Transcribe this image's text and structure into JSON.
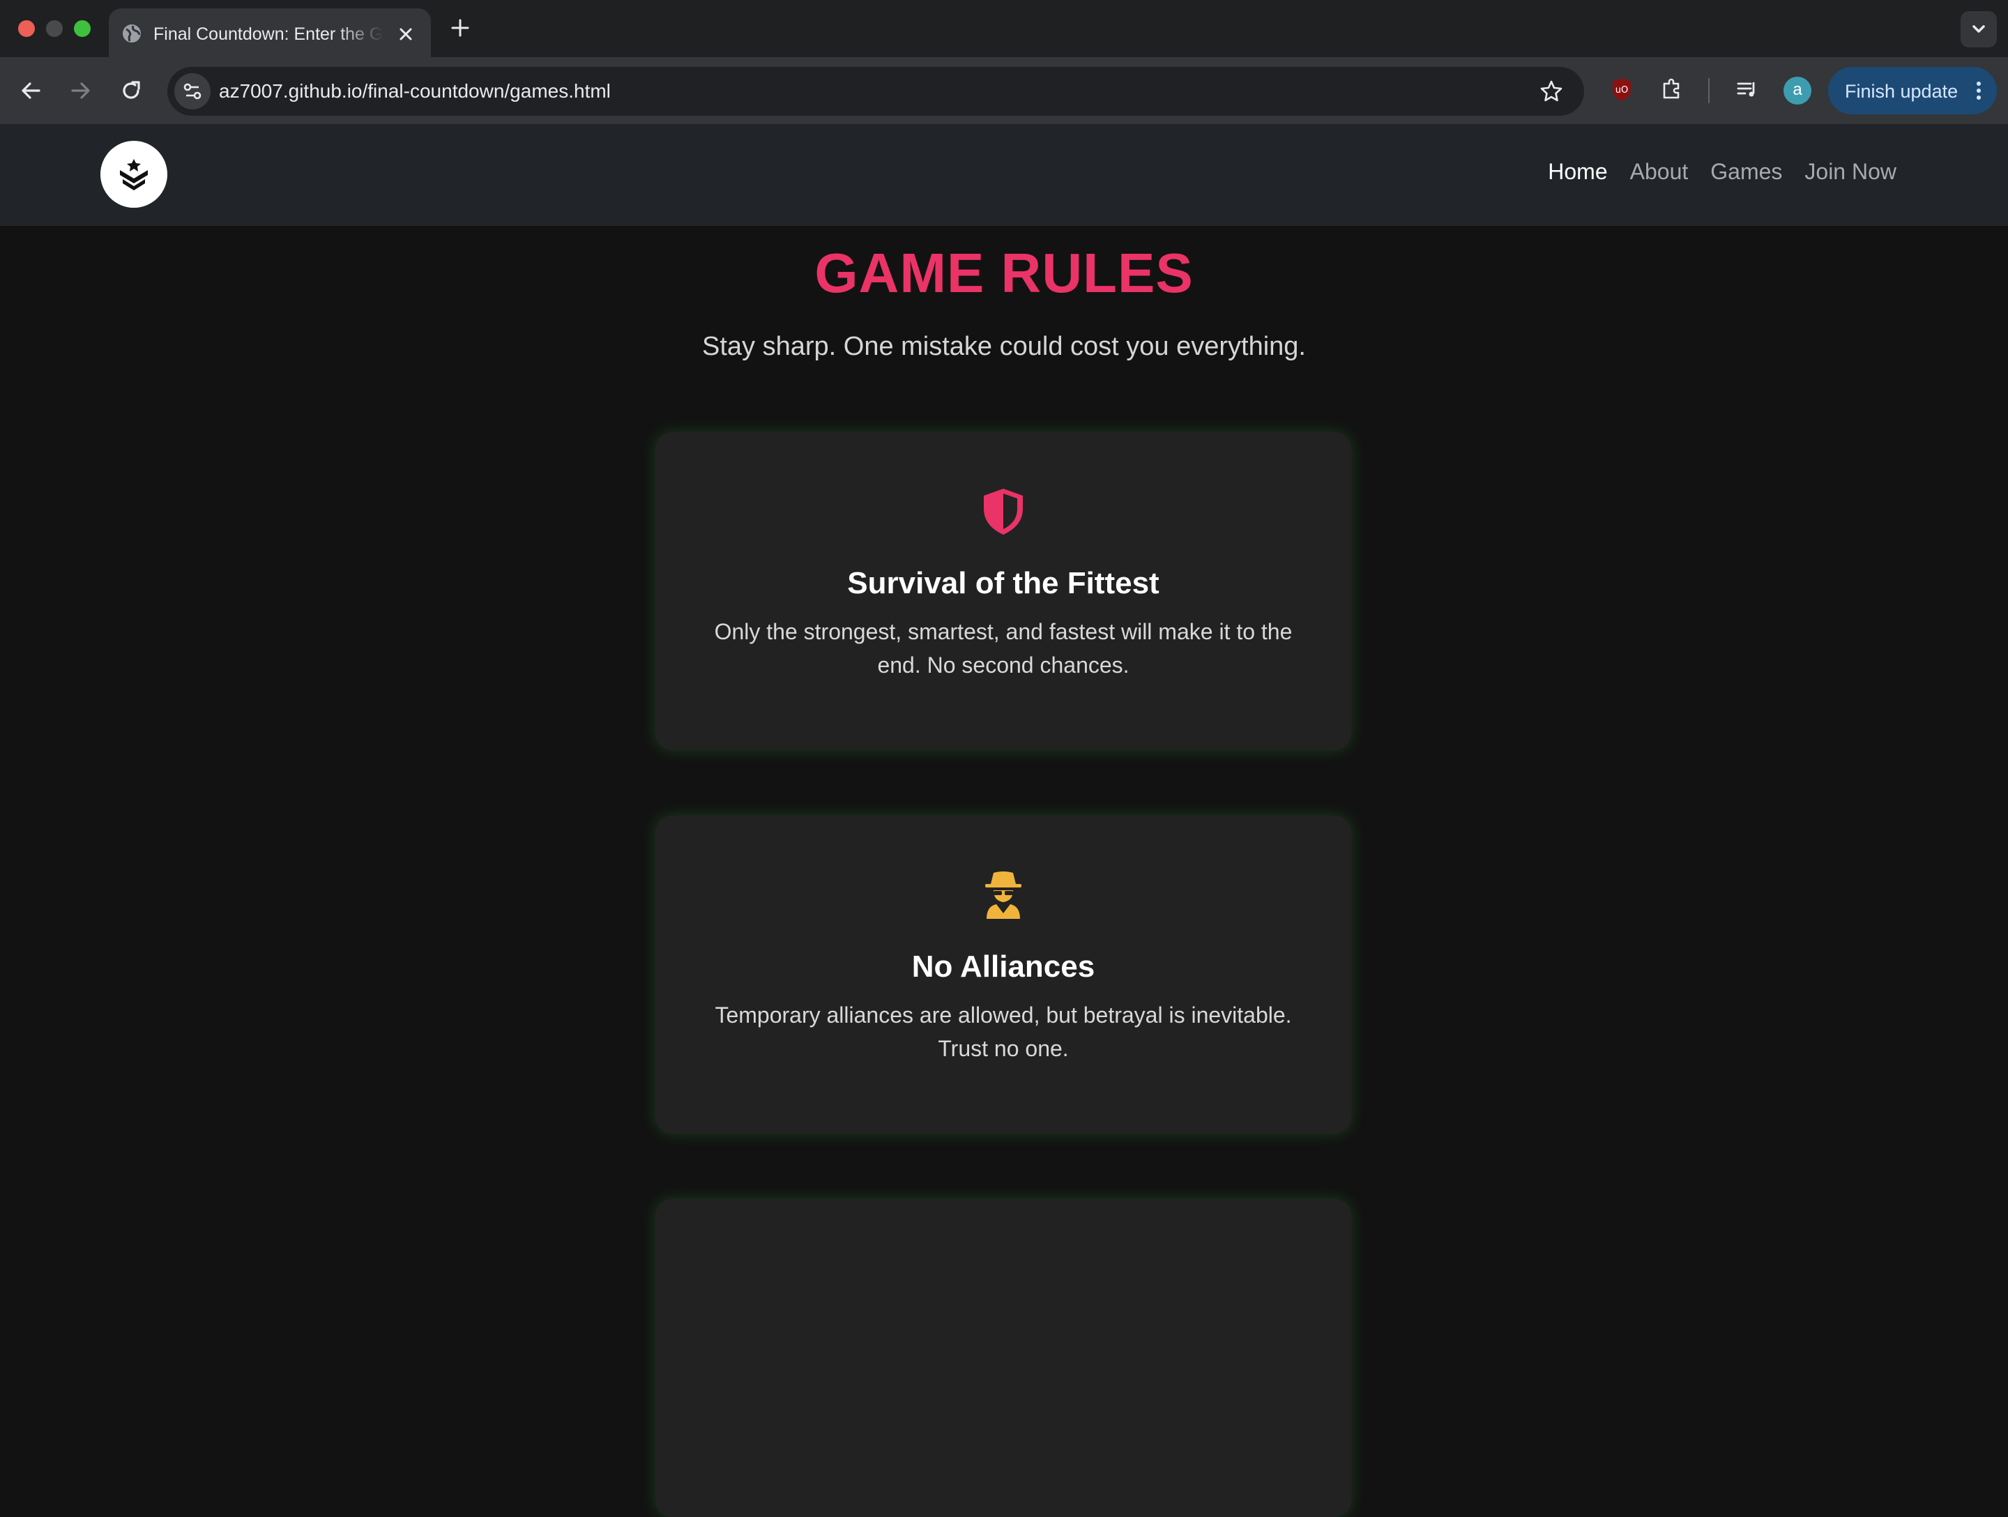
{
  "browser": {
    "tab_title": "Final Countdown: Enter the Game",
    "url": "az7007.github.io/final-countdown/games.html",
    "profile_initial": "a",
    "update_label": "Finish update",
    "colors": {
      "update_button": "#1c4a75",
      "avatar": "#3e9cb0"
    }
  },
  "nav": {
    "links": [
      {
        "label": "Home",
        "active": true
      },
      {
        "label": "About",
        "active": false
      },
      {
        "label": "Games",
        "active": false
      },
      {
        "label": "Join Now",
        "active": false
      }
    ]
  },
  "page": {
    "title": "GAME RULES",
    "subtitle": "Stay sharp. One mistake could cost you everything.",
    "colors": {
      "title": "#ea3366",
      "card_glow": "#2e9634"
    }
  },
  "rules": [
    {
      "icon": "shield-icon",
      "icon_color": "#ea3366",
      "title": "Survival of the Fittest",
      "text": "Only the strongest, smartest, and fastest will make it to the end. No second chances."
    },
    {
      "icon": "spy-icon",
      "icon_color": "#f0b43c",
      "title": "No Alliances",
      "text": "Temporary alliances are allowed, but betrayal is inevitable. Trust no one."
    },
    {
      "icon": "",
      "title": "",
      "text": ""
    }
  ]
}
